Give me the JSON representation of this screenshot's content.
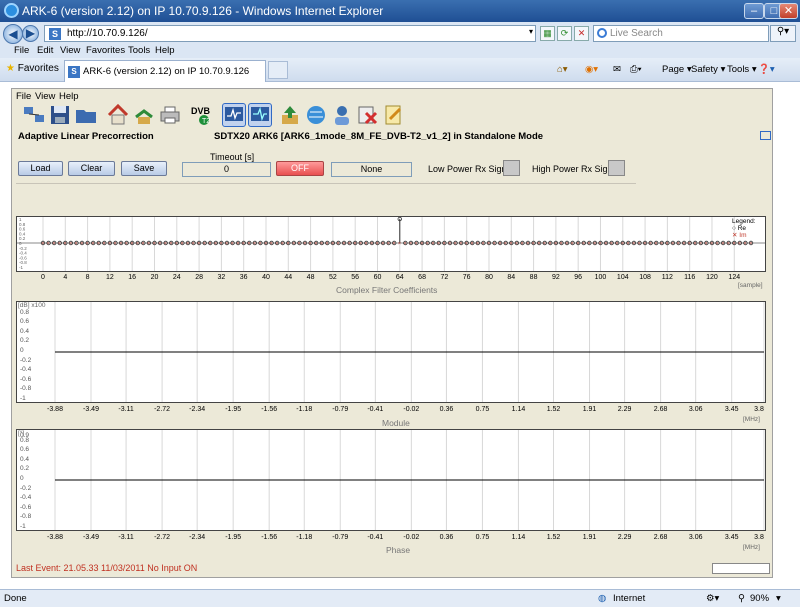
{
  "window": {
    "title": "ARK-6 (version 2.12) on IP 10.70.9.126 - Windows Internet Explorer"
  },
  "address": {
    "url": "http://10.70.9.126/",
    "search_placeholder": "Live Search"
  },
  "menu": {
    "items": [
      "File",
      "Edit",
      "View",
      "Favorites",
      "Tools",
      "Help"
    ]
  },
  "favbar": {
    "favorites_label": "Favorites",
    "tab_title": "ARK-6 (version 2.12) on IP 10.70.9.126",
    "commands": [
      "Page",
      "Safety",
      "Tools"
    ]
  },
  "app": {
    "menu": [
      "File",
      "View",
      "Help"
    ],
    "mode_title": "Adaptive Linear Precorrection",
    "subtitle": "SDTX20 ARK6 [ARK6_1mode_8M_FE_DVB-T2_v1_2] in Standalone Mode",
    "toolbar_icons": [
      "network-icon",
      "save-disk-icon",
      "folder-icon",
      "home-icon",
      "recycle-icon",
      "printer-icon",
      "dvbt2-icon",
      "oscilloscope-icon",
      "monitor-wave-icon",
      "upload-icon",
      "globe-icon",
      "user-icon",
      "delete-icon",
      "notepad-icon"
    ],
    "controls": {
      "load": "Load",
      "clear": "Clear",
      "save": "Save",
      "timeout_label": "Timeout [s]",
      "timeout_value": "0",
      "off": "OFF",
      "none": "None",
      "low_power": "Low Power Rx Signal",
      "high_power": "High Power Rx Signal"
    },
    "last_event": "Last Event: 21.05.33 11/03/2011 No Input ON"
  },
  "charts": [
    {
      "name": "Complex Filter Coefficients",
      "type": "scatter",
      "x_ticks": [
        "0",
        "4",
        "8",
        "12",
        "16",
        "20",
        "24",
        "28",
        "32",
        "36",
        "40",
        "44",
        "48",
        "52",
        "56",
        "60",
        "64",
        "68",
        "72",
        "76",
        "80",
        "84",
        "88",
        "92",
        "96",
        "100",
        "104",
        "108",
        "112",
        "116",
        "120",
        "124"
      ],
      "x_unit": "[sample]",
      "legend": {
        "title": "Legend:",
        "re": "Re",
        "im": "Im"
      }
    },
    {
      "name": "Module",
      "type": "line",
      "y_unit": "[dB] x100",
      "y_ticks": [
        "0.8",
        "0.6",
        "0.4",
        "0.2",
        "0",
        "-0.2",
        "-0.4",
        "-0.6",
        "-0.8",
        "-1"
      ],
      "x_ticks": [
        "-3.88",
        "-3.49",
        "-3.11",
        "-2.72",
        "-2.34",
        "-1.95",
        "-1.56",
        "-1.18",
        "-0.79",
        "-0.41",
        "-0.02",
        "0.36",
        "0.75",
        "1.14",
        "1.52",
        "1.91",
        "2.29",
        "2.68",
        "3.06",
        "3.45",
        "3.8"
      ],
      "x_unit": "[MHz]"
    },
    {
      "name": "Phase",
      "type": "line",
      "y_unit": "[°]",
      "y_ticks": [
        "0.9",
        "0.8",
        "0.6",
        "0.4",
        "0.2",
        "0",
        "-0.2",
        "-0.4",
        "-0.6",
        "-0.8",
        "-1"
      ],
      "x_ticks": [
        "-3.88",
        "-3.49",
        "-3.11",
        "-2.72",
        "-2.34",
        "-1.95",
        "-1.56",
        "-1.18",
        "-0.79",
        "-0.41",
        "-0.02",
        "0.36",
        "0.75",
        "1.14",
        "1.52",
        "1.91",
        "2.29",
        "2.68",
        "3.06",
        "3.45",
        "3.8"
      ],
      "x_unit": "[MHz]"
    }
  ],
  "chart_data": [
    {
      "type": "scatter",
      "title": "Complex Filter Coefficients",
      "xlabel": "[sample]",
      "xlim": [
        0,
        127
      ],
      "series": [
        {
          "name": "Re",
          "impulse_at": 64,
          "impulse_value": 1,
          "other_values": 0
        },
        {
          "name": "Im",
          "values_all": 0
        }
      ]
    },
    {
      "type": "line",
      "title": "Module",
      "ylabel": "[dB] x100",
      "xlabel": "[MHz]",
      "xlim": [
        -3.88,
        3.8
      ],
      "ylim": [
        -1,
        1
      ],
      "values_all": 0
    },
    {
      "type": "line",
      "title": "Phase",
      "ylabel": "[°]",
      "xlabel": "[MHz]",
      "xlim": [
        -3.88,
        3.8
      ],
      "ylim": [
        -1,
        1
      ],
      "values_all": 0
    }
  ],
  "statusbar": {
    "left": "Done",
    "zone": "Internet",
    "zoom": "90%"
  },
  "colors": {
    "re_marker": "#333333",
    "im_marker": "#c0392b",
    "last_event": "#c03020",
    "off_button": "#e85050"
  }
}
